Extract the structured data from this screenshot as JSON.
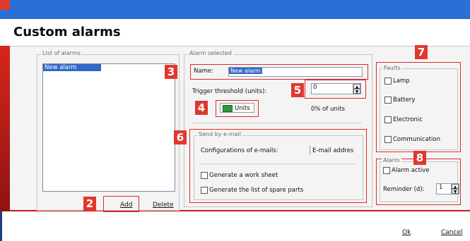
{
  "window": {
    "title": "Custom alarms"
  },
  "colors": {
    "accent_blue": "#2a6fd6",
    "highlight_red": "#e0382e",
    "selection": "#3169c6"
  },
  "list_of_alarms": {
    "legend": "List of alarms",
    "items": [
      "New alarm"
    ],
    "add_label": "Add",
    "delete_label": "Delete"
  },
  "alarm_selected": {
    "legend": "Alarm selected",
    "name_label": "Name:",
    "name_value": "New alarm",
    "threshold_label": "Trigger threshold (units):",
    "threshold_value": "0",
    "units_button": "Units",
    "percent_text": "0% of units"
  },
  "send_email": {
    "legend": "Send by e-mail",
    "config_label": "Configurations of e-mails:",
    "email_col": "E-mail addres",
    "checkbox_worksheet": "Generate a work sheet",
    "checkbox_spare_parts": "Generate the list of spare parts"
  },
  "faults": {
    "legend": "Faults",
    "items": [
      "Lamp",
      "Battery",
      "Electronic",
      "Communication"
    ]
  },
  "alarm": {
    "legend": "Alarm",
    "active_label": "Alarm active",
    "reminder_label": "Reminder (d):",
    "reminder_value": "1"
  },
  "footer": {
    "ok_label": "Ok",
    "cancel_label": "Cancel"
  },
  "badges": [
    "2",
    "3",
    "4",
    "5",
    "6",
    "7",
    "8"
  ]
}
